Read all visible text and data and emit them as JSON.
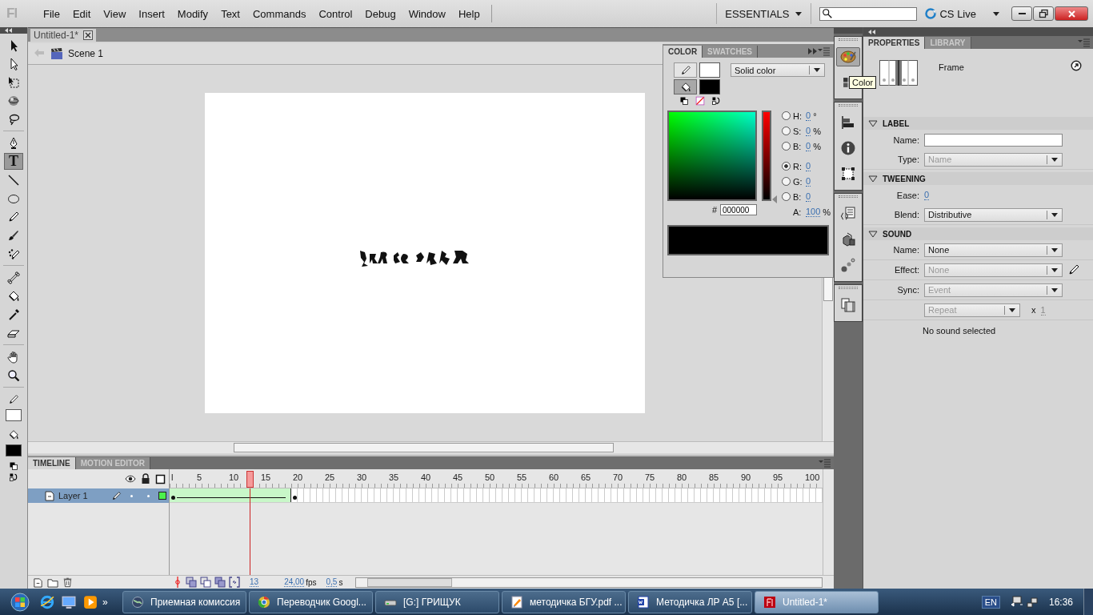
{
  "app": {
    "logo": "Fl",
    "menu": [
      "File",
      "Edit",
      "View",
      "Insert",
      "Modify",
      "Text",
      "Commands",
      "Control",
      "Debug",
      "Window",
      "Help"
    ],
    "workspace": "ESSENTIALS",
    "cs_live": "CS Live"
  },
  "tools": [
    [
      {
        "kind": "selection",
        "selected": false
      },
      {
        "kind": "subselection",
        "selected": false
      },
      {
        "kind": "free-transform",
        "selected": false
      },
      {
        "kind": "rotation",
        "selected": false
      },
      {
        "kind": "lasso",
        "selected": false
      }
    ],
    [
      {
        "kind": "pen",
        "selected": false
      },
      {
        "kind": "text",
        "glyph": "T",
        "selected": true
      },
      {
        "kind": "line",
        "selected": false
      },
      {
        "kind": "oval",
        "selected": false
      },
      {
        "kind": "pencil",
        "selected": false
      },
      {
        "kind": "brush",
        "selected": false
      },
      {
        "kind": "deco",
        "selected": false
      }
    ],
    [
      {
        "kind": "bone",
        "selected": false
      },
      {
        "kind": "paint-bucket",
        "selected": false
      },
      {
        "kind": "eyedropper",
        "selected": false
      },
      {
        "kind": "eraser",
        "selected": false
      }
    ],
    [
      {
        "kind": "hand",
        "selected": false
      },
      {
        "kind": "zoom",
        "selected": false
      }
    ]
  ],
  "tool_swatches": [
    {
      "kind": "stroke",
      "color": "#ffffff"
    },
    {
      "kind": "fill",
      "color": "#000000"
    }
  ],
  "document": {
    "tab": "Untitled-1*",
    "scene": "Scene 1"
  },
  "color_panel": {
    "tabs": [
      {
        "label": "COLOR",
        "selected": true
      },
      {
        "label": "SWATCHES",
        "selected": false
      }
    ],
    "targets": [
      {
        "kind": "stroke",
        "selected": false,
        "color": "#ffffff"
      },
      {
        "kind": "fill",
        "selected": true,
        "color": "#000000"
      }
    ],
    "type": "Solid color",
    "fields": [
      {
        "label": "H:",
        "value": "0",
        "unit": "°",
        "selected": false
      },
      {
        "label": "S:",
        "value": "0",
        "unit": "%",
        "selected": false
      },
      {
        "label": "B:",
        "value": "0",
        "unit": "%",
        "selected": false
      },
      {
        "label": "R:",
        "value": "0",
        "selected": true
      },
      {
        "label": "G:",
        "value": "0",
        "selected": false
      },
      {
        "label": "B:",
        "value": "0",
        "selected": false
      }
    ],
    "hex_label": "#",
    "hex": "000000",
    "alpha": {
      "label": "A:",
      "value": "100",
      "unit": "%"
    }
  },
  "tooltip": "Color",
  "properties": {
    "tabs": [
      {
        "label": "PROPERTIES",
        "selected": true
      },
      {
        "label": "LIBRARY",
        "selected": false
      }
    ],
    "kind_label": "Frame",
    "sections": [
      {
        "title": "LABEL",
        "expanded": true,
        "rows": [
          {
            "kind": "input",
            "label": "Name:"
          },
          {
            "kind": "select",
            "label": "Type:",
            "value": "Name",
            "disabled": true
          }
        ]
      },
      {
        "title": "TWEENING",
        "expanded": true,
        "rows": [
          {
            "kind": "number",
            "label": "Ease:",
            "value": "0"
          },
          {
            "kind": "select",
            "label": "Blend:",
            "value": "Distributive",
            "disabled": false
          }
        ]
      },
      {
        "title": "SOUND",
        "expanded": true,
        "rows": [
          {
            "kind": "select",
            "label": "Name:",
            "value": "None",
            "disabled": false
          },
          {
            "kind": "select",
            "label": "Effect:",
            "value": "None",
            "disabled": true,
            "editable": true
          },
          {
            "kind": "select",
            "label": "Sync:",
            "value": "Event",
            "disabled": true
          },
          {
            "kind": "repeat",
            "value": "Repeat",
            "disabled": true,
            "times_label": "x",
            "times": "1"
          },
          {
            "kind": "note",
            "text": "No sound selected"
          }
        ]
      }
    ]
  },
  "timeline": {
    "tabs": [
      {
        "label": "TIMELINE",
        "selected": true
      },
      {
        "label": "MOTION EDITOR",
        "selected": false
      }
    ],
    "ruler": [
      "l",
      "5",
      "10",
      "15",
      "20",
      "25",
      "30",
      "35",
      "40",
      "45",
      "50",
      "55",
      "60",
      "65",
      "70",
      "75",
      "80",
      "85",
      "90",
      "95",
      "100"
    ],
    "layers": [
      {
        "name": "Layer 1",
        "selected": true,
        "color": "#4cf04c"
      }
    ],
    "current_frame": "13",
    "fps": "24,00",
    "fps_unit": "fps",
    "time": "0,5",
    "time_unit": "s"
  },
  "taskbar": {
    "quick_launch": [
      {
        "kind": "browser"
      },
      {
        "kind": "desktop"
      },
      {
        "kind": "media"
      }
    ],
    "more": "»",
    "tasks": [
      {
        "kind": "globe",
        "label": "Приемная комиссия",
        "selected": false
      },
      {
        "kind": "chrome",
        "label": "Переводчик Googl...",
        "selected": false
      },
      {
        "kind": "drive",
        "label": "[G:] ГРИЩУК",
        "selected": false
      },
      {
        "kind": "pdf",
        "label": "методичка БГУ.pdf ...",
        "selected": false
      },
      {
        "kind": "word",
        "label": "Методичка ЛР А5 [...",
        "selected": false
      },
      {
        "kind": "flash",
        "label": "Untitled-1*",
        "selected": true
      }
    ],
    "language": "EN",
    "clock": "16:36"
  }
}
